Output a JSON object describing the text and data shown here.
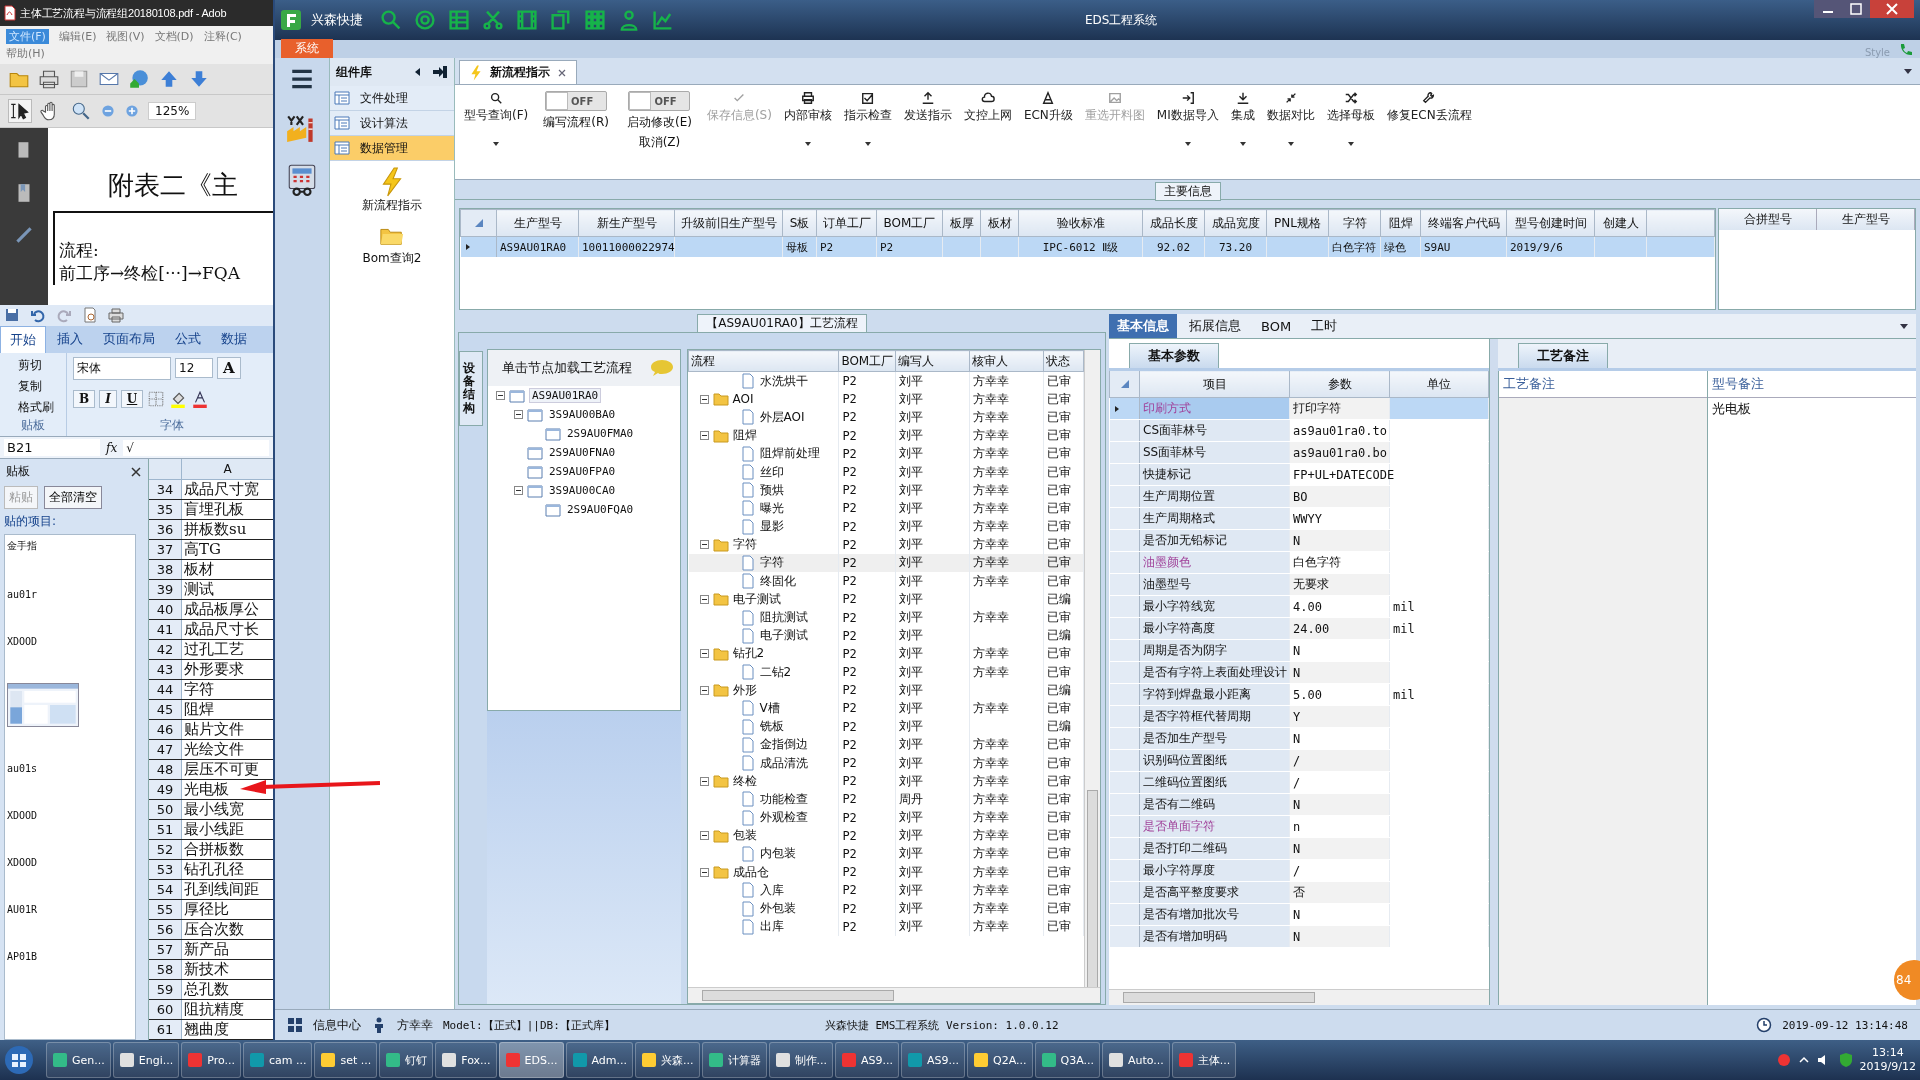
{
  "adobe": {
    "title": "主体工艺流程与流程组20180108.pdf - Adob",
    "menu": [
      {
        "label": "文件(F)",
        "selected": true
      },
      {
        "label": "编辑(E)",
        "selected": false
      },
      {
        "label": "视图(V)",
        "selected": false
      },
      {
        "label": "文档(D)",
        "selected": false
      },
      {
        "label": "注释(C)",
        "selected": false
      },
      {
        "label": "帮助(H)",
        "selected": false
      }
    ],
    "zoom": "125%",
    "doc_heading": "附表二《主",
    "doc_lines": [
      "流程:",
      "前工序→终检[···]→FQA"
    ]
  },
  "excel": {
    "tabs": [
      {
        "label": "开始",
        "selected": true
      },
      {
        "label": "插入",
        "selected": false
      },
      {
        "label": "页面布局",
        "selected": false
      },
      {
        "label": "公式",
        "selected": false
      },
      {
        "label": "数据",
        "selected": false
      }
    ],
    "clipboard_actions": [
      "剪切",
      "复制",
      "格式刷"
    ],
    "clipboard_group": "贴板",
    "font_name": "宋体",
    "font_size": "12",
    "font_group": "字体",
    "format_buttons": [
      "B",
      "I",
      "U"
    ],
    "grow_font": "A",
    "name_box": "B21",
    "fx": "fx",
    "formula": "√",
    "pane_title": "贴板",
    "pane_buttons": [
      {
        "label": "粘贴",
        "disabled": true
      },
      {
        "label": "全部清空",
        "disabled": false
      }
    ],
    "pane_label": "贴的项目:",
    "pane_items": [
      {
        "kind": "text",
        "text": "金手指"
      },
      {
        "kind": "text",
        "text": "au01r"
      },
      {
        "kind": "text",
        "text": "XDOOD"
      },
      {
        "kind": "picture"
      },
      {
        "kind": "text",
        "text": "au01s"
      },
      {
        "kind": "text",
        "text": "XDOOD"
      },
      {
        "kind": "text",
        "text": "XDOOD"
      },
      {
        "kind": "text",
        "text": "AU01R"
      },
      {
        "kind": "text",
        "text": "AP01B"
      }
    ],
    "column": "A",
    "rows": [
      {
        "n": "34",
        "text": "成品尺寸宽"
      },
      {
        "n": "35",
        "text": "盲埋孔板"
      },
      {
        "n": "36",
        "text": "拼板数su"
      },
      {
        "n": "37",
        "text": "高TG"
      },
      {
        "n": "38",
        "text": "板材"
      },
      {
        "n": "39",
        "text": "测试"
      },
      {
        "n": "40",
        "text": "成品板厚公"
      },
      {
        "n": "41",
        "text": "成品尺寸长"
      },
      {
        "n": "42",
        "text": "过孔工艺"
      },
      {
        "n": "43",
        "text": "外形要求"
      },
      {
        "n": "44",
        "text": "字符"
      },
      {
        "n": "45",
        "text": "阻焊"
      },
      {
        "n": "46",
        "text": "贴片文件"
      },
      {
        "n": "47",
        "text": "光绘文件"
      },
      {
        "n": "48",
        "text": "层压不可更"
      },
      {
        "n": "49",
        "text": "光电板"
      },
      {
        "n": "50",
        "text": "最小线宽"
      },
      {
        "n": "51",
        "text": "最小线距"
      },
      {
        "n": "52",
        "text": "合拼板数"
      },
      {
        "n": "53",
        "text": "钻孔孔径"
      },
      {
        "n": "54",
        "text": "孔到线间距"
      },
      {
        "n": "55",
        "text": "厚径比"
      },
      {
        "n": "56",
        "text": "压合次数"
      },
      {
        "n": "57",
        "text": "新产品"
      },
      {
        "n": "58",
        "text": "新技术"
      },
      {
        "n": "59",
        "text": "总孔数"
      },
      {
        "n": "60",
        "text": "阻抗精度"
      },
      {
        "n": "61",
        "text": "翘曲度"
      }
    ]
  },
  "eds": {
    "brand": "兴森快捷",
    "title": "EDS工程系统",
    "style_label": "Style",
    "system_tab": "系统",
    "library": {
      "title": "组件库",
      "groups": [
        {
          "label": "文件处理",
          "selected": false
        },
        {
          "label": "设计算法",
          "selected": false
        },
        {
          "label": "数据管理",
          "selected": true
        }
      ],
      "tools": [
        "新流程指示",
        "Bom查询2"
      ]
    },
    "doc_tab": "新流程指示",
    "toolbar": [
      {
        "kind": "button",
        "label": "型号查询(F)",
        "dropdown": true,
        "disabled": false
      },
      {
        "kind": "toggle",
        "label": "编写流程(R)",
        "switch": "OFF",
        "on": false
      },
      {
        "kind": "toggle",
        "label": "启动修改(E)",
        "label2": "取消(Z)",
        "switch": "OFF",
        "on": false
      },
      {
        "kind": "button",
        "label": "保存信息(S)",
        "dropdown": false,
        "disabled": true
      },
      {
        "kind": "button",
        "label": "内部审核",
        "dropdown": true,
        "disabled": false
      },
      {
        "kind": "button",
        "label": "指示检查",
        "dropdown": true,
        "disabled": false
      },
      {
        "kind": "button",
        "label": "发送指示",
        "dropdown": false,
        "disabled": false
      },
      {
        "kind": "button",
        "label": "文控上网",
        "dropdown": false,
        "disabled": false
      },
      {
        "kind": "button",
        "label": "ECN升级",
        "dropdown": false,
        "disabled": false
      },
      {
        "kind": "button",
        "label": "重选开料图",
        "dropdown": false,
        "disabled": true
      },
      {
        "kind": "button",
        "label": "MI数据导入",
        "dropdown": true,
        "disabled": false
      },
      {
        "kind": "button",
        "label": "集成",
        "dropdown": true,
        "disabled": false
      },
      {
        "kind": "button",
        "label": "数据对比",
        "dropdown": true,
        "disabled": false
      },
      {
        "kind": "button",
        "label": "选择母板",
        "dropdown": true,
        "disabled": false
      },
      {
        "kind": "button",
        "label": "修复ECN丢流程",
        "dropdown": false,
        "disabled": false
      }
    ],
    "main_info": {
      "title": "主要信息",
      "columns": [
        "生产型号",
        "新生产型号",
        "升级前旧生产型号",
        "S板",
        "订单工厂",
        "BOM工厂",
        "板厚",
        "板材",
        "验收标准",
        "成品长度",
        "成品宽度",
        "PNL规格",
        "字符",
        "阻焊",
        "终端客户代码",
        "型号创建时间",
        "创建人"
      ],
      "rows": [
        {
          "selected": true,
          "cells": [
            "AS9AU01RA0",
            "10011000022974",
            null,
            "母板",
            "P2",
            "P2",
            null,
            null,
            "IPC-6012 Ⅱ级",
            "92.02",
            "73.20",
            null,
            "白色字符",
            "绿色",
            "S9AU",
            "2019/9/6",
            null
          ]
        }
      ],
      "side_columns": [
        "合拼型号",
        "生产型号"
      ]
    },
    "flow": {
      "title": "【AS9AU01RA0】工艺流程",
      "side_tab": "设备结构",
      "tree_header": "单击节点加载工艺流程",
      "tree": [
        {
          "label": "AS9AU01RA0",
          "selected": true,
          "expanded": true,
          "children": [
            {
              "label": "3S9AU00BA0",
              "selected": false,
              "expanded": true,
              "children": [
                {
                  "label": "2S9AU0FMA0",
                  "selected": false
                }
              ]
            },
            {
              "label": "2S9AU0FNA0",
              "selected": false
            },
            {
              "label": "2S9AU0FPA0",
              "selected": false
            },
            {
              "label": "3S9AU00CA0",
              "selected": false,
              "expanded": true,
              "children": [
                {
                  "label": "2S9AU0FQA0",
                  "selected": false
                }
              ]
            }
          ]
        }
      ],
      "columns": [
        "流程",
        "BOM工厂",
        "编写人",
        "核审人",
        "状态"
      ],
      "steps": [
        {
          "kind": "step",
          "name": "水洗烘干",
          "bom": "P2",
          "writer": "刘平",
          "reviewer": "方幸幸",
          "status": "已审",
          "selected": false
        },
        {
          "kind": "group",
          "name": "AOI",
          "bom": "P2",
          "writer": "刘平",
          "reviewer": "方幸幸",
          "status": "已审",
          "selected": false,
          "expanded": true,
          "children": [
            {
              "kind": "step",
              "name": "外层AOI",
              "bom": "P2",
              "writer": "刘平",
              "reviewer": "方幸幸",
              "status": "已审",
              "selected": false
            }
          ]
        },
        {
          "kind": "group",
          "name": "阻焊",
          "bom": "P2",
          "writer": "刘平",
          "reviewer": "方幸幸",
          "status": "已审",
          "selected": false,
          "expanded": true,
          "children": [
            {
              "kind": "step",
              "name": "阻焊前处理",
              "bom": "P2",
              "writer": "刘平",
              "reviewer": "方幸幸",
              "status": "已审",
              "selected": false
            },
            {
              "kind": "step",
              "name": "丝印",
              "bom": "P2",
              "writer": "刘平",
              "reviewer": "方幸幸",
              "status": "已审",
              "selected": false
            },
            {
              "kind": "step",
              "name": "预烘",
              "bom": "P2",
              "writer": "刘平",
              "reviewer": "方幸幸",
              "status": "已审",
              "selected": false
            },
            {
              "kind": "step",
              "name": "曝光",
              "bom": "P2",
              "writer": "刘平",
              "reviewer": "方幸幸",
              "status": "已审",
              "selected": false
            },
            {
              "kind": "step",
              "name": "显影",
              "bom": "P2",
              "writer": "刘平",
              "reviewer": "方幸幸",
              "status": "已审",
              "selected": false
            }
          ]
        },
        {
          "kind": "group",
          "name": "字符",
          "bom": "P2",
          "writer": "刘平",
          "reviewer": "方幸幸",
          "status": "已审",
          "selected": false,
          "expanded": true,
          "children": [
            {
              "kind": "step",
              "name": "字符",
              "bom": "P2",
              "writer": "刘平",
              "reviewer": "方幸幸",
              "status": "已审",
              "selected": true
            },
            {
              "kind": "step",
              "name": "终固化",
              "bom": "P2",
              "writer": "刘平",
              "reviewer": "方幸幸",
              "status": "已审",
              "selected": false
            }
          ]
        },
        {
          "kind": "group",
          "name": "电子测试",
          "bom": "P2",
          "writer": "刘平",
          "status": "已编",
          "selected": false,
          "expanded": true,
          "children": [
            {
              "kind": "step",
              "name": "阻抗测试",
              "bom": "P2",
              "writer": "刘平",
              "reviewer": "方幸幸",
              "status": "已审",
              "selected": false
            },
            {
              "kind": "step",
              "name": "电子测试",
              "bom": "P2",
              "writer": "刘平",
              "status": "已编",
              "selected": false
            }
          ]
        },
        {
          "kind": "group",
          "name": "钻孔2",
          "bom": "P2",
          "writer": "刘平",
          "reviewer": "方幸幸",
          "status": "已审",
          "selected": false,
          "expanded": true,
          "children": [
            {
              "kind": "step",
              "name": "二钻2",
              "bom": "P2",
              "writer": "刘平",
              "reviewer": "方幸幸",
              "status": "已审",
              "selected": false
            }
          ]
        },
        {
          "kind": "group",
          "name": "外形",
          "bom": "P2",
          "writer": "刘平",
          "status": "已编",
          "selected": false,
          "expanded": true,
          "children": [
            {
              "kind": "step",
              "name": "V槽",
              "bom": "P2",
              "writer": "刘平",
              "reviewer": "方幸幸",
              "status": "已审",
              "selected": false
            },
            {
              "kind": "step",
              "name": "铣板",
              "bom": "P2",
              "writer": "刘平",
              "status": "已编",
              "selected": false
            },
            {
              "kind": "step",
              "name": "金指倒边",
              "bom": "P2",
              "writer": "刘平",
              "reviewer": "方幸幸",
              "status": "已审",
              "selected": false
            },
            {
              "kind": "step",
              "name": "成品清洗",
              "bom": "P2",
              "writer": "刘平",
              "reviewer": "方幸幸",
              "status": "已审",
              "selected": false
            }
          ]
        },
        {
          "kind": "group",
          "name": "终检",
          "bom": "P2",
          "writer": "刘平",
          "reviewer": "方幸幸",
          "status": "已审",
          "selected": false,
          "expanded": true,
          "children": [
            {
              "kind": "step",
              "name": "功能检查",
              "bom": "P2",
              "writer": "周丹",
              "reviewer": "方幸幸",
              "status": "已审",
              "selected": false
            },
            {
              "kind": "step",
              "name": "外观检查",
              "bom": "P2",
              "writer": "刘平",
              "reviewer": "方幸幸",
              "status": "已审",
              "selected": false
            }
          ]
        },
        {
          "kind": "group",
          "name": "包装",
          "bom": "P2",
          "writer": "刘平",
          "reviewer": "方幸幸",
          "status": "已审",
          "selected": false,
          "expanded": true,
          "children": [
            {
              "kind": "step",
              "name": "内包装",
              "bom": "P2",
              "writer": "刘平",
              "reviewer": "方幸幸",
              "status": "已审",
              "selected": false
            }
          ]
        },
        {
          "kind": "group",
          "name": "成品仓",
          "bom": "P2",
          "writer": "刘平",
          "reviewer": "方幸幸",
          "status": "已审",
          "selected": false,
          "expanded": true,
          "children": [
            {
              "kind": "step",
              "name": "入库",
              "bom": "P2",
              "writer": "刘平",
              "reviewer": "方幸幸",
              "status": "已审",
              "selected": false
            },
            {
              "kind": "step",
              "name": "外包装",
              "bom": "P2",
              "writer": "刘平",
              "reviewer": "方幸幸",
              "status": "已审",
              "selected": false
            },
            {
              "kind": "step",
              "name": "出库",
              "bom": "P2",
              "writer": "刘平",
              "reviewer": "方幸幸",
              "status": "已审",
              "selected": false
            }
          ]
        }
      ]
    },
    "info": {
      "tabs": [
        {
          "label": "基本信息",
          "selected": true
        },
        {
          "label": "拓展信息",
          "selected": false
        },
        {
          "label": "BOM",
          "selected": false
        },
        {
          "label": "工时",
          "selected": false
        }
      ],
      "param_tab": "基本参数",
      "columns": [
        "项目",
        "参数",
        "单位"
      ],
      "params": [
        {
          "item": "印刷方式",
          "value": "打印字符",
          "flagged": true,
          "selected": true
        },
        {
          "item": "CS面菲林号",
          "value": "as9au01ra0.to",
          "flagged": false,
          "selected": false
        },
        {
          "item": "SS面菲林号",
          "value": "as9au01ra0.bo",
          "flagged": false,
          "selected": false
        },
        {
          "item": "快捷标记",
          "value": "FP+UL+DATECODE",
          "flagged": false,
          "selected": false
        },
        {
          "item": "生产周期位置",
          "value": "BO",
          "flagged": false,
          "selected": false
        },
        {
          "item": "生产周期格式",
          "value": "WWYY",
          "flagged": false,
          "selected": false
        },
        {
          "item": "是否加无铅标记",
          "value": "N",
          "flagged": false,
          "selected": false
        },
        {
          "item": "油墨颜色",
          "value": "白色字符",
          "flagged": true,
          "selected": false
        },
        {
          "item": "油墨型号",
          "value": "无要求",
          "flagged": false,
          "selected": false
        },
        {
          "item": "最小字符线宽",
          "value": "4.00",
          "unit": "mil",
          "flagged": false,
          "selected": false
        },
        {
          "item": "最小字符高度",
          "value": "24.00",
          "unit": "mil",
          "flagged": false,
          "selected": false
        },
        {
          "item": "周期是否为阴字",
          "value": "N",
          "flagged": false,
          "selected": false
        },
        {
          "item": "是否有字符上表面处理设计",
          "value": "N",
          "flagged": false,
          "selected": false
        },
        {
          "item": "字符到焊盘最小距离",
          "value": "5.00",
          "unit": "mil",
          "flagged": false,
          "selected": false
        },
        {
          "item": "是否字符框代替周期",
          "value": "Y",
          "flagged": false,
          "selected": false
        },
        {
          "item": "是否加生产型号",
          "value": "N",
          "flagged": false,
          "selected": false
        },
        {
          "item": "识别码位置图纸",
          "value": "/",
          "flagged": false,
          "selected": false
        },
        {
          "item": "二维码位置图纸",
          "value": "/",
          "flagged": false,
          "selected": false
        },
        {
          "item": "是否有二维码",
          "value": "N",
          "flagged": false,
          "selected": false
        },
        {
          "item": "是否单面字符",
          "value": "n",
          "flagged": true,
          "selected": false
        },
        {
          "item": "是否打印二维码",
          "value": "N",
          "flagged": false,
          "selected": false
        },
        {
          "item": "最小字符厚度",
          "value": "/",
          "flagged": false,
          "selected": false
        },
        {
          "item": "是否高平整度要求",
          "value": "否",
          "flagged": false,
          "selected": false
        },
        {
          "item": "是否有增加批次号",
          "value": "N",
          "flagged": false,
          "selected": false
        },
        {
          "item": "是否有增加明码",
          "value": "N",
          "flagged": false,
          "selected": false
        }
      ],
      "remarks_tab": "工艺备注",
      "remark_columns": [
        "工艺备注",
        "型号备注"
      ],
      "model_remark": "光电板"
    },
    "status": {
      "info_center": "信息中心",
      "user": "方幸幸",
      "model_db": "Model:【正式】||DB:【正式库】",
      "version": "兴森快捷 EMS工程系统 Version: 1.0.0.12",
      "datetime": "2019-09-12 13:14:48",
      "badge": "84"
    }
  },
  "taskbar": {
    "items": [
      {
        "label": "Gen...",
        "selected": false
      },
      {
        "label": "Engi...",
        "selected": false
      },
      {
        "label": "Pro...",
        "selected": false
      },
      {
        "label": "cam ...",
        "selected": false
      },
      {
        "label": "set ...",
        "selected": false
      },
      {
        "label": "钉钉",
        "selected": false
      },
      {
        "label": "Fox...",
        "selected": false
      },
      {
        "label": "EDS...",
        "selected": true
      },
      {
        "label": "Adm...",
        "selected": false
      },
      {
        "label": "兴森...",
        "selected": false
      },
      {
        "label": "计算器",
        "selected": false
      },
      {
        "label": "制作...",
        "selected": false
      },
      {
        "label": "AS9...",
        "selected": false
      },
      {
        "label": "AS9...",
        "selected": false
      },
      {
        "label": "Q2A...",
        "selected": false
      },
      {
        "label": "Q3A...",
        "selected": false
      },
      {
        "label": "Auto...",
        "selected": false
      },
      {
        "label": "主体...",
        "selected": false
      }
    ],
    "time": "13:14",
    "date": "2019/9/12"
  }
}
